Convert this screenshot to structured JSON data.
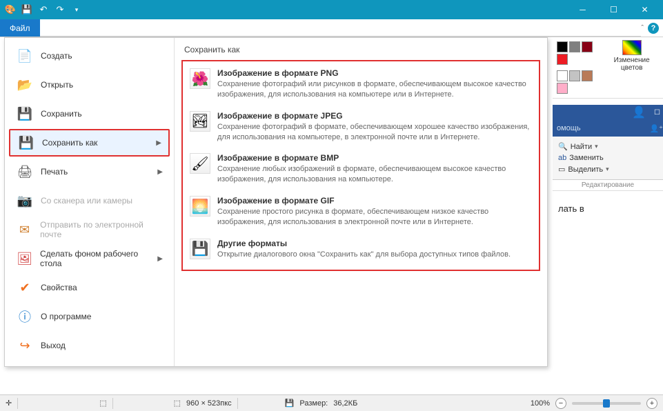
{
  "title_bar": {
    "qat_icons": [
      "palette-icon",
      "save-icon",
      "undo-icon",
      "redo-icon",
      "dropdown-icon"
    ]
  },
  "file_tab": "Файл",
  "menu": {
    "items": [
      {
        "label": "Создать",
        "icon": "📄",
        "class": "ic-new"
      },
      {
        "label": "Открыть",
        "icon": "📂",
        "class": "ic-open"
      },
      {
        "label": "Сохранить",
        "icon": "💾",
        "class": "ic-save"
      },
      {
        "label": "Сохранить как",
        "icon": "💾",
        "class": "ic-saveas",
        "highlighted": true,
        "arrow": true
      },
      {
        "label": "Печать",
        "icon": "🖨",
        "class": "ic-print",
        "arrow": true
      },
      {
        "label": "Со сканера или камеры",
        "icon": "📷",
        "class": "ic-scanner",
        "disabled": true
      },
      {
        "label": "Отправить по электронной почте",
        "icon": "✉",
        "class": "ic-mail",
        "disabled": true
      },
      {
        "label": "Сделать фоном рабочего стола",
        "icon": "🖼",
        "class": "ic-desktop",
        "arrow": true
      },
      {
        "label": "Свойства",
        "icon": "✔",
        "class": "ic-prop"
      },
      {
        "label": "О программе",
        "icon": "ⓘ",
        "class": "ic-about"
      },
      {
        "label": "Выход",
        "icon": "↪",
        "class": "ic-exit"
      }
    ]
  },
  "submenu": {
    "header": "Сохранить как",
    "items": [
      {
        "title": "Изображение в формате PNG",
        "desc": "Сохранение фотографий или рисунков в формате, обеспечивающем высокое качество изображения, для использования на компьютере или в Интернете.",
        "icon": "🌺"
      },
      {
        "title": "Изображение в формате JPEG",
        "desc": "Сохранение фотографий в формате, обеспечивающем хорошее качество изображения, для использования на компьютере, в электронной почте или в Интернете.",
        "icon": "🏞"
      },
      {
        "title": "Изображение в формате BMP",
        "desc": "Сохранение любых изображений в формате, обеспечивающем высокое качество изображения, для использования на компьютере.",
        "icon": "🖌"
      },
      {
        "title": "Изображение в формате GIF",
        "desc": "Сохранение простого рисунка в формате, обеспечивающем низкое качество изображения, для использования в электронной почте или в Интернете.",
        "icon": "🌅"
      },
      {
        "title": "Другие форматы",
        "desc": "Открытие диалогового окна \"Сохранить как\" для выбора доступных типов файлов.",
        "icon": "💾"
      }
    ]
  },
  "colors": {
    "edit_label": "Изменение цветов",
    "swatches_row1": [
      "#000000",
      "#7f7f7f",
      "#880015",
      "#ed1c24",
      "#ff7f27",
      "#fff200",
      "#22b14c",
      "#00a2e8",
      "#3f48cc",
      "#a349a4"
    ],
    "swatches_row2": [
      "#ffffff",
      "#c3c3c3",
      "#b97a57",
      "#ffaec9",
      "#ffc90e",
      "#efe4b0",
      "#b5e61d",
      "#99d9ea",
      "#7092be",
      "#c8bfe7"
    ]
  },
  "word": {
    "tab_help": "омощь",
    "find": "Найти",
    "replace": "Заменить",
    "select": "Выделить",
    "group": "Редактирование",
    "doc_fragment": "лать в"
  },
  "status": {
    "dimensions": "960 × 523пкс",
    "size_label": "Размер:",
    "size_value": "36,2КБ",
    "zoom": "100%"
  }
}
